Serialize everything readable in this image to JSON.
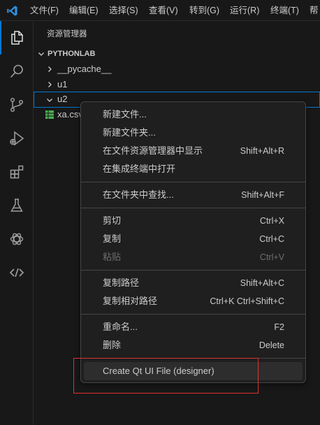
{
  "menubar": {
    "items": [
      "文件(F)",
      "编辑(E)",
      "选择(S)",
      "查看(V)",
      "转到(G)",
      "运行(R)",
      "终端(T)",
      "帮"
    ]
  },
  "activity_bar": {
    "icons": [
      "explorer-icon",
      "search-icon",
      "source-control-icon",
      "run-debug-icon",
      "extensions-icon",
      "testing-icon",
      "openai-icon",
      "remote-icon"
    ]
  },
  "sidebar": {
    "title": "资源管理器",
    "section": "PYTHONLAB",
    "tree": [
      {
        "label": "__pycache__",
        "type": "folder",
        "expanded": false
      },
      {
        "label": "u1",
        "type": "folder",
        "expanded": false
      },
      {
        "label": "u2",
        "type": "folder",
        "expanded": true,
        "selected": true
      },
      {
        "label": "xa.csv",
        "type": "file"
      }
    ]
  },
  "context_menu": {
    "groups": [
      [
        {
          "label": "新建文件...",
          "key": ""
        },
        {
          "label": "新建文件夹...",
          "key": ""
        },
        {
          "label": "在文件资源管理器中显示",
          "key": "Shift+Alt+R"
        },
        {
          "label": "在集成终端中打开",
          "key": ""
        }
      ],
      [
        {
          "label": "在文件夹中查找...",
          "key": "Shift+Alt+F"
        }
      ],
      [
        {
          "label": "剪切",
          "key": "Ctrl+X"
        },
        {
          "label": "复制",
          "key": "Ctrl+C"
        },
        {
          "label": "粘贴",
          "key": "Ctrl+V",
          "disabled": true
        }
      ],
      [
        {
          "label": "复制路径",
          "key": "Shift+Alt+C"
        },
        {
          "label": "复制相对路径",
          "key": "Ctrl+K Ctrl+Shift+C"
        }
      ],
      [
        {
          "label": "重命名...",
          "key": "F2"
        },
        {
          "label": "删除",
          "key": "Delete"
        }
      ],
      [
        {
          "label": "Create Qt UI File (designer)",
          "key": "",
          "hover": true
        }
      ]
    ]
  },
  "colors": {
    "accent": "#0078d4",
    "highlight_box": "#e03030",
    "csv_icon": "#4caf50"
  }
}
